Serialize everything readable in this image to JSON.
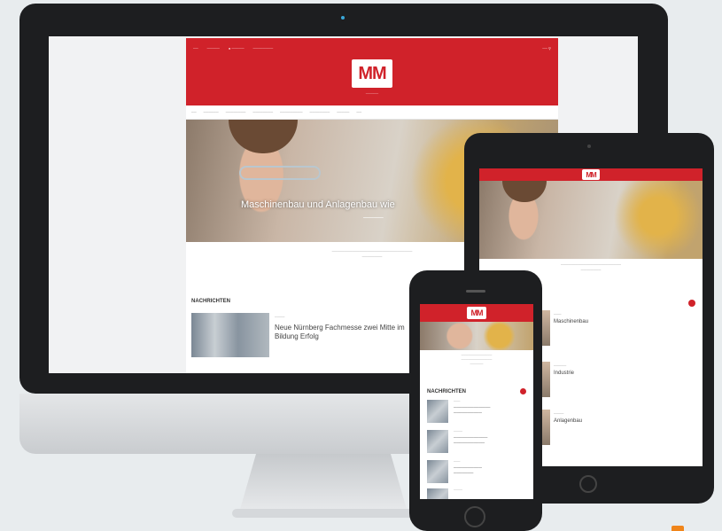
{
  "brand": {
    "logo": "MM",
    "accent_red": "#d0222a",
    "frame_black": "#1d1e20"
  },
  "desktop": {
    "hero_caption": "Maschinenbau und Anlagenbau wie",
    "section_title": "NACHRICHTEN",
    "news_title": "Neue Nürnberg Fachmesse zwei Mitte im Bildung Erfolg"
  },
  "tablet": {
    "items": [
      {
        "title": "Maschinenbau"
      },
      {
        "title": "Industrie"
      },
      {
        "title": "Anlagenbau"
      }
    ]
  },
  "phone": {
    "section_title": "NACHRICHTEN"
  }
}
